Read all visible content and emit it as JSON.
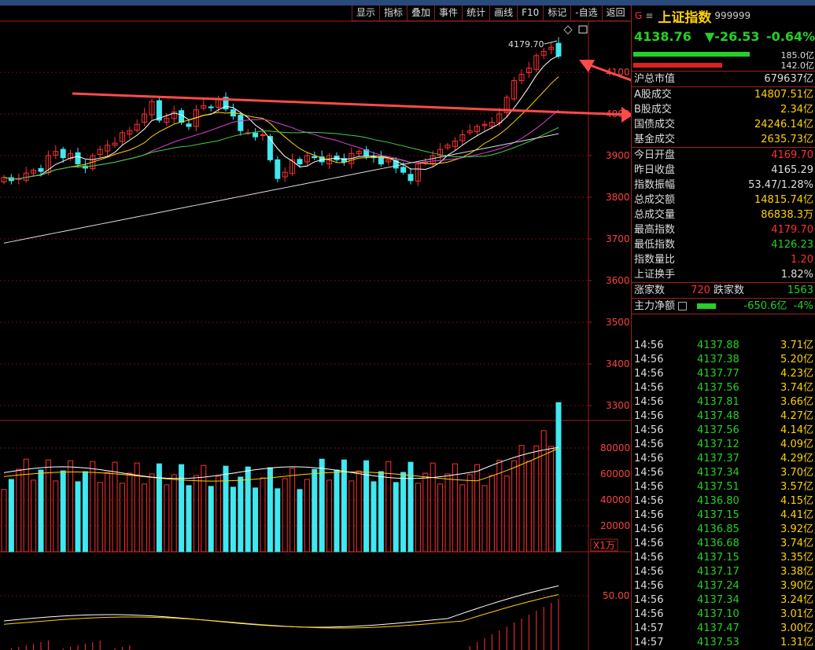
{
  "toolbar": [
    "显示",
    "指标",
    "叠加",
    "事件",
    "统计",
    "画线",
    "F10",
    "标记",
    "-自选",
    "返回"
  ],
  "header": {
    "g": "G",
    "menu": "≡",
    "name": "上证指数",
    "code": "999999"
  },
  "quote": {
    "last": "4138.76",
    "change": "▼-26.53",
    "pct": "-0.64%"
  },
  "flow": {
    "up": "185.0亿",
    "down": "142.0亿",
    "up_frac": 0.82,
    "down_frac": 0.63
  },
  "stats1": [
    {
      "label": "沪总市值",
      "value": "679637亿",
      "cls": ""
    }
  ],
  "stats2": [
    {
      "label": "A股成交",
      "value": "14807.51亿",
      "cls": "yellow"
    },
    {
      "label": "B股成交",
      "value": "2.34亿",
      "cls": "yellow"
    },
    {
      "label": "国债成交",
      "value": "24246.14亿",
      "cls": "yellow"
    },
    {
      "label": "基金成交",
      "value": "2635.73亿",
      "cls": "yellow"
    }
  ],
  "stats3": [
    {
      "label": "今日开盘",
      "value": "4169.70",
      "cls": "red"
    },
    {
      "label": "昨日收盘",
      "value": "4165.29",
      "cls": ""
    },
    {
      "label": "指数振幅",
      "value": "53.47/1.28%",
      "cls": ""
    },
    {
      "label": "总成交额",
      "value": "14815.74亿",
      "cls": "yellow"
    },
    {
      "label": "总成交量",
      "value": "86838.3万",
      "cls": "yellow"
    },
    {
      "label": "最高指数",
      "value": "4179.70",
      "cls": "red"
    },
    {
      "label": "最低指数",
      "value": "4126.23",
      "cls": "green"
    },
    {
      "label": "指数量比",
      "value": "1.20",
      "cls": "red"
    },
    {
      "label": "上证换手",
      "value": "1.82%",
      "cls": ""
    }
  ],
  "breadth": {
    "up_label": "涨家数",
    "up": "720",
    "down_label": "跌家数",
    "down": "1563"
  },
  "mainflow": {
    "label": "主力净额",
    "icon": "list-icon",
    "value": "-650.6亿",
    "pct": "-4%"
  },
  "ticks": [
    {
      "t": "14:56",
      "p": "4137.88",
      "v": "3.71亿"
    },
    {
      "t": "14:56",
      "p": "4137.38",
      "v": "5.20亿"
    },
    {
      "t": "14:56",
      "p": "4137.77",
      "v": "4.23亿"
    },
    {
      "t": "14:56",
      "p": "4137.56",
      "v": "3.74亿"
    },
    {
      "t": "14:56",
      "p": "4137.81",
      "v": "3.66亿"
    },
    {
      "t": "14:56",
      "p": "4137.48",
      "v": "4.27亿"
    },
    {
      "t": "14:56",
      "p": "4137.56",
      "v": "4.14亿"
    },
    {
      "t": "14:56",
      "p": "4137.12",
      "v": "4.09亿"
    },
    {
      "t": "14:56",
      "p": "4137.37",
      "v": "4.29亿"
    },
    {
      "t": "14:56",
      "p": "4137.34",
      "v": "3.70亿"
    },
    {
      "t": "14:56",
      "p": "4137.51",
      "v": "3.57亿"
    },
    {
      "t": "14:56",
      "p": "4136.80",
      "v": "4.15亿"
    },
    {
      "t": "14:56",
      "p": "4137.15",
      "v": "4.41亿"
    },
    {
      "t": "14:56",
      "p": "4136.85",
      "v": "3.92亿"
    },
    {
      "t": "14:56",
      "p": "4136.68",
      "v": "3.74亿"
    },
    {
      "t": "14:56",
      "p": "4137.15",
      "v": "3.35亿"
    },
    {
      "t": "14:56",
      "p": "4137.17",
      "v": "3.38亿"
    },
    {
      "t": "14:56",
      "p": "4137.24",
      "v": "3.90亿"
    },
    {
      "t": "14:56",
      "p": "4137.34",
      "v": "3.24亿"
    },
    {
      "t": "14:56",
      "p": "4137.10",
      "v": "3.01亿"
    },
    {
      "t": "14:57",
      "p": "4137.47",
      "v": "3.00亿"
    },
    {
      "t": "14:57",
      "p": "4137.53",
      "v": "1.31亿"
    }
  ],
  "chart_data": {
    "type": "candlestick",
    "price_axis": [
      4100,
      4000,
      3900,
      3800,
      3700,
      3600,
      3500,
      3400,
      3300
    ],
    "high_label": "4179.70",
    "volume_axis": [
      80000,
      60000,
      40000,
      20000
    ],
    "volume_unit": "X1万",
    "macd_axis": [
      50.0
    ]
  },
  "colors": {
    "up": "#ff3030",
    "down": "#40e8f0",
    "grid": "#6a1010",
    "axis": "#a02020"
  }
}
